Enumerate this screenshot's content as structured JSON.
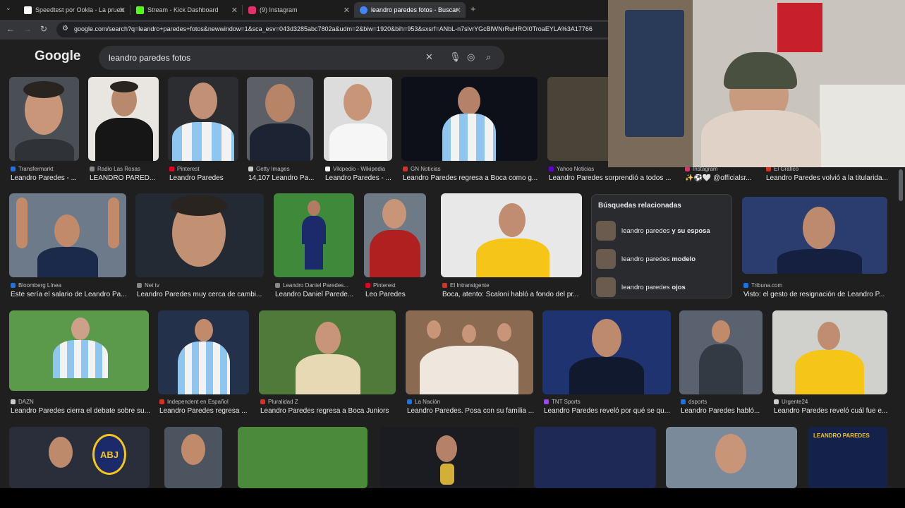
{
  "tabs": [
    {
      "label": "Speedtest por Ookla - La prueb",
      "favicon_color": "#ffffff"
    },
    {
      "label": "Stream - Kick Dashboard",
      "favicon_color": "#53fc18"
    },
    {
      "label": "(9) Instagram",
      "favicon_color": "#e1306c"
    },
    {
      "label": "leandro paredes fotos - Buscar",
      "favicon_color": "#4285f4"
    }
  ],
  "address": {
    "url": "google.com/search?q=leandro+paredes+fotos&newwindow=1&sca_esv=043d3285abc7802a&udm=2&biw=1920&bih=953&sxsrf=ANbL-n7slvrYGcBlWNrRuHROI0TroaEYLA%3A17766"
  },
  "google": {
    "logo": "Google",
    "query": "leandro paredes fotos"
  },
  "results_row1": [
    {
      "source": "Transfermarkt",
      "caption": "Leandro Paredes - ...",
      "dot": "#1a73e8"
    },
    {
      "source": "Radio Las Rosas",
      "caption": "LEANDRO PARED...",
      "dot": "#888888"
    },
    {
      "source": "Pinterest",
      "caption": "Leandro Paredes",
      "dot": "#e60023"
    },
    {
      "source": "Getty Images",
      "caption": "14,107 Leandro Pa...",
      "dot": "#cccccc"
    },
    {
      "source": "Vikipedio - Wikipedia",
      "caption": "Leandro Paredes - ...",
      "dot": "#ffffff"
    },
    {
      "source": "GN Noticias",
      "caption": "Leandro Paredes regresa a Boca como g...",
      "dot": "#d93025"
    },
    {
      "source": "Yahoo Noticias",
      "caption": "Leandro Paredes sorprendió a todos ...",
      "dot": "#6001d2"
    },
    {
      "source": "Instagram",
      "caption": "✨⚽️🤍 @officialsr...",
      "dot": "#e1306c"
    },
    {
      "source": "El Gráfico",
      "caption": "Leandro Paredes volvió a la titularida...",
      "dot": "#d93025"
    }
  ],
  "results_row2": [
    {
      "source": "Bloomberg Línea",
      "caption": "Este sería el salario de Leandro Pa...",
      "dot": "#1a73e8"
    },
    {
      "source": "Net tv",
      "caption": "Leandro Paredes muy cerca de cambi...",
      "dot": "#888888"
    },
    {
      "source": "Leandro Daniel Paredes...",
      "caption": "Leandro Daniel Parede...",
      "dot": "#888888"
    },
    {
      "source": "Pinterest",
      "caption": "Leo Paredes",
      "dot": "#e60023"
    },
    {
      "source": "El Intransigente",
      "caption": "Boca, atento: Scaloni habló a fondo del pr...",
      "dot": "#d93025"
    },
    {
      "source": "Tribuna.com",
      "caption": "Visto: el gesto de resignación de Leandro P...",
      "dot": "#1a73e8"
    }
  ],
  "related": {
    "title": "Búsquedas relacionadas",
    "items": [
      {
        "prefix": "leandro paredes ",
        "bold": "y su esposa"
      },
      {
        "prefix": "leandro paredes ",
        "bold": "modelo"
      },
      {
        "prefix": "leandro paredes ",
        "bold": "ojos"
      }
    ]
  },
  "results_row3": [
    {
      "source": "DAZN",
      "caption": "Leandro Paredes cierra el debate sobre su...",
      "dot": "#cccccc"
    },
    {
      "source": "Independent en Español",
      "caption": "Leandro Paredes regresa ...",
      "dot": "#d93025"
    },
    {
      "source": "Pluralidad Z",
      "caption": "Leandro Paredes regresa a Boca Juniors",
      "dot": "#d93025"
    },
    {
      "source": "La Nación",
      "caption": "Leandro Paredes. Posa con su familia ...",
      "dot": "#1a73e8"
    },
    {
      "source": "TNT Sports",
      "caption": "Leandro Paredes reveló por qué se qu...",
      "dot": "#a142f4"
    },
    {
      "source": "dsports",
      "caption": "Leandro Paredes habló...",
      "dot": "#1a73e8"
    },
    {
      "source": "Urgente24",
      "caption": "Leandro Paredes reveló cuál fue e...",
      "dot": "#cccccc"
    }
  ],
  "row4_labels": {
    "abj": "ABJ",
    "banner": "LEANDRO PAREDES"
  }
}
